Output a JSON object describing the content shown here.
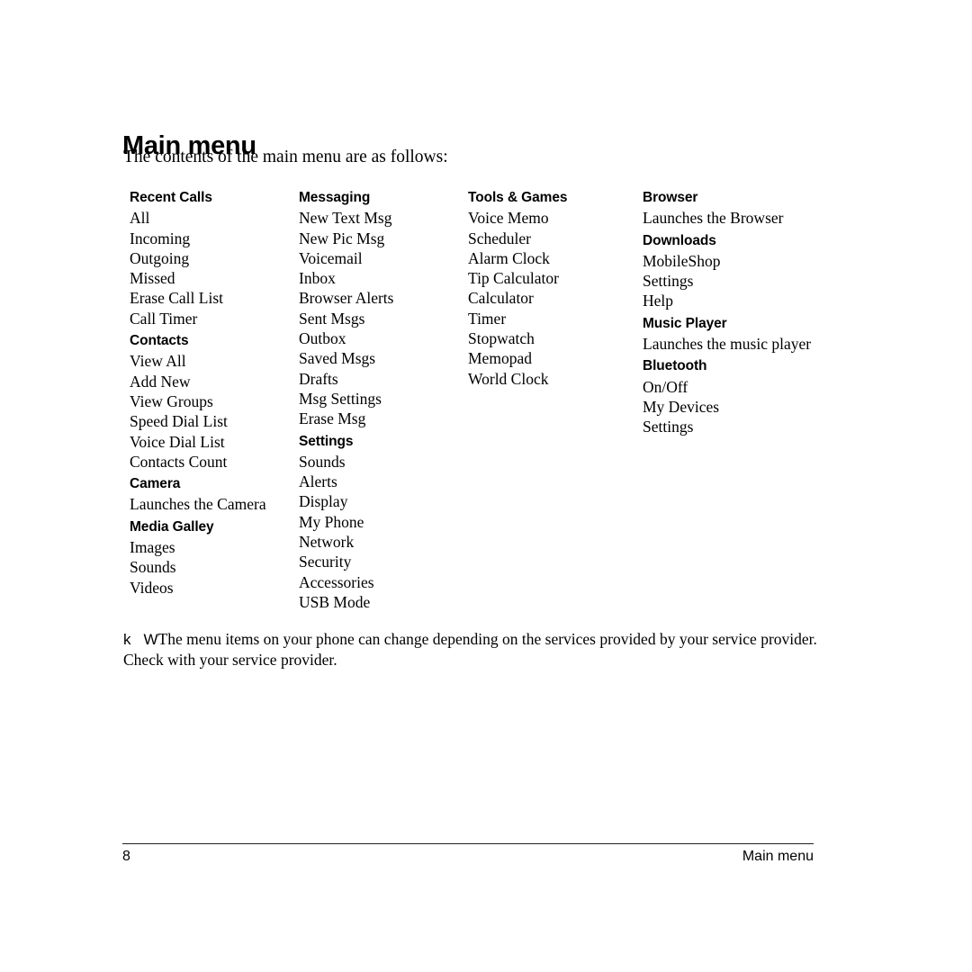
{
  "document": {
    "title": "Main menu",
    "intro": "The contents of the main menu are as follows:"
  },
  "menu_columns": [
    {
      "groups": [
        {
          "heading": "Recent Calls",
          "items": [
            "All",
            "Incoming",
            "Outgoing",
            "Missed",
            "Erase Call List",
            "Call Timer"
          ]
        },
        {
          "heading": "Contacts",
          "items": [
            "View All",
            "Add New",
            "View Groups",
            "Speed Dial List",
            "Voice Dial List",
            "Contacts Count"
          ]
        },
        {
          "heading": "Camera",
          "items": [
            "Launches the Camera"
          ]
        },
        {
          "heading": "Media Galley",
          "items": [
            "Images",
            "Sounds",
            "Videos"
          ]
        }
      ]
    },
    {
      "groups": [
        {
          "heading": "Messaging",
          "items": [
            "New Text Msg",
            "New Pic Msg",
            "Voicemail",
            "Inbox",
            "Browser Alerts",
            "Sent Msgs",
            "Outbox",
            "Saved Msgs",
            "Drafts",
            "Msg Settings",
            "Erase Msg"
          ]
        },
        {
          "heading": "Settings",
          "items": [
            "Sounds",
            "Alerts",
            "Display",
            "My Phone",
            "Network",
            "Security",
            "Accessories",
            "USB Mode"
          ]
        }
      ]
    },
    {
      "groups": [
        {
          "heading": "Tools & Games",
          "items": [
            "Voice Memo",
            "Scheduler",
            "Alarm Clock",
            "Tip Calculator",
            "Calculator",
            "Timer",
            "Stopwatch",
            "Memopad",
            "World Clock"
          ]
        }
      ]
    },
    {
      "groups": [
        {
          "heading": "Browser",
          "items": [
            "Launches the Browser"
          ]
        },
        {
          "heading": "Downloads",
          "items": [
            "MobileShop",
            "Settings",
            "Help"
          ]
        },
        {
          "heading": "Music Player",
          "items": [
            "Launches the music player"
          ]
        },
        {
          "heading": "Bluetooth",
          "items": [
            "On/Off",
            "My Devices",
            "Settings"
          ]
        }
      ]
    }
  ],
  "note": {
    "mark_1": "k",
    "mark_2": "W",
    "text": "The menu items on your phone can change depending on the services provided by your service provider. Check with your service provider."
  },
  "footer": {
    "page_number": "8",
    "chapter": "Main menu"
  }
}
